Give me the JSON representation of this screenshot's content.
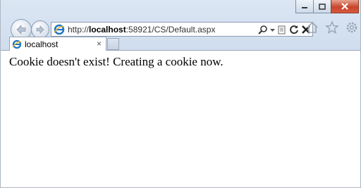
{
  "window": {
    "controls": {
      "minimize_icon": "minimize-icon",
      "maximize_icon": "maximize-icon",
      "close_icon": "close-icon"
    }
  },
  "navigation": {
    "back_icon": "back-arrow-icon",
    "forward_icon": "forward-arrow-icon"
  },
  "address_bar": {
    "url_prefix": "http://",
    "url_host": "localhost",
    "url_path": ":58921/CS/Default.aspx",
    "icons": [
      "ie-favicon-icon",
      "search-icon",
      "dropdown-icon",
      "compatibility-icon",
      "refresh-icon",
      "stop-icon"
    ]
  },
  "toolbar": {
    "icons": [
      "home-icon",
      "favorites-star-icon",
      "settings-gear-icon"
    ]
  },
  "tabs": [
    {
      "label": "localhost",
      "close": "×"
    }
  ],
  "page": {
    "message": "Cookie doesn't exist! Creating a cookie now."
  },
  "colors": {
    "chrome": "#d6e2f1",
    "close_button": "#c9452d",
    "ie_logo": "#1f74c4"
  }
}
